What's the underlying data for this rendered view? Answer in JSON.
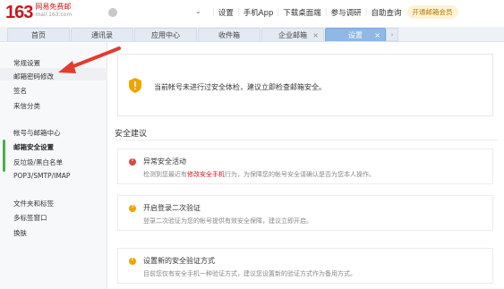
{
  "header": {
    "logo_number": "163",
    "logo_cn": "网易免费邮",
    "logo_url": "mail.163.com",
    "nav": [
      "设置",
      "手机App",
      "下载桌面端",
      "参与调研",
      "自助查询"
    ],
    "upgrade_label": "开通邮箱会员"
  },
  "tabs": [
    {
      "label": "首页",
      "closable": false
    },
    {
      "label": "通讯录",
      "closable": false
    },
    {
      "label": "应用中心",
      "closable": false
    },
    {
      "label": "收件箱",
      "closable": false
    },
    {
      "label": "企业邮箱",
      "closable": true
    },
    {
      "label": "设置",
      "closable": true,
      "active": true
    }
  ],
  "tab_close": "×",
  "tab_more": "›",
  "sidebar": {
    "items": [
      "常规设置",
      "邮箱密码修改",
      "签名",
      "来信分类",
      "帐号与邮箱中心",
      "邮箱安全设置",
      "反垃圾/黑白名单",
      "POP3/SMTP/IMAP",
      "文件夹和标签",
      "多标签窗口",
      "换肤"
    ],
    "selected": "邮箱安全设置"
  },
  "main": {
    "notice": "当前帐号未进行过安全体检，建议立即检查邮箱安全。",
    "section_title": "安全建议",
    "cards": [
      {
        "title": "异常安全活动",
        "desc_pre": "检测到您最近有",
        "desc_link": "修改安全手机",
        "desc_post": "行为，为保障您的帐号安全请确认是否为您本人操作。",
        "icon_color": "#e0463f"
      },
      {
        "title": "开启登录二次验证",
        "desc_pre": "登录二次验证为您的帐号提供有效安全保障，建议立即开启。",
        "desc_link": "",
        "desc_post": "",
        "icon_color": "#f0a400"
      },
      {
        "title": "设置新的安全验证方式",
        "desc_pre": "目前您仅有安全手机一种验证方式，建议您设置新的验证方式作为备用方式。",
        "desc_link": "",
        "desc_post": "",
        "icon_color": "#f0a400"
      }
    ]
  },
  "colors": {
    "brand": "#c8161d",
    "active_tab": "#8fb8e6",
    "warning": "#f0a400",
    "danger": "#e0463f",
    "arrow": "#e33b2e"
  }
}
